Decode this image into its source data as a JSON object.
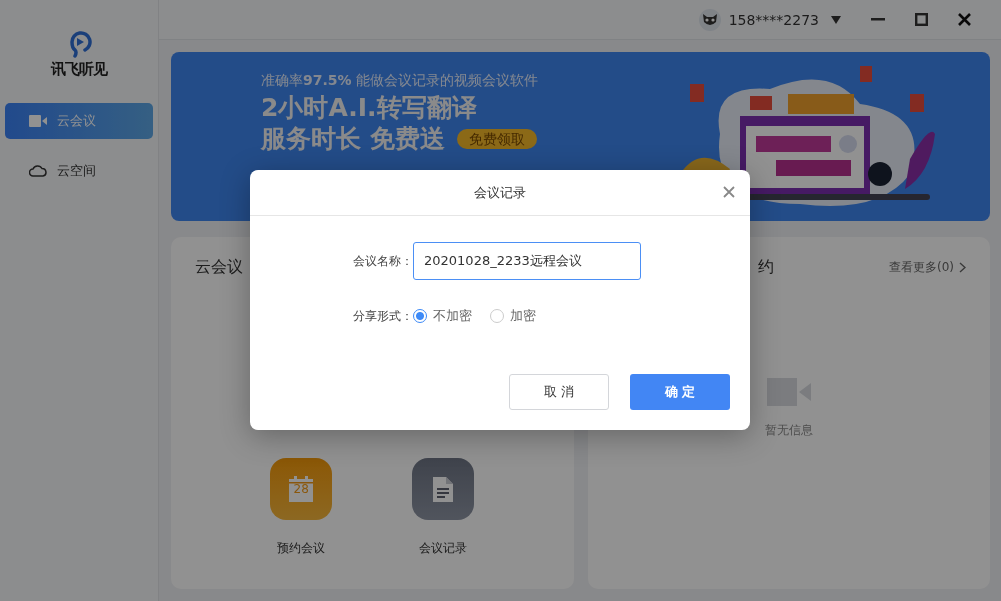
{
  "window": {
    "user": "158****2273"
  },
  "sidebar": {
    "logo": "讯飞听见",
    "items": [
      {
        "label": "云会议",
        "selected": true,
        "kind": "video"
      },
      {
        "label": "云空间",
        "selected": false,
        "kind": "cloud"
      }
    ]
  },
  "banner": {
    "tagline": "准确率**97.5%** 能做会议记录的视频会议软件",
    "headline": "2小时A.I.转写翻译",
    "subline": "服务时长 免费送",
    "cta": "免费领取"
  },
  "meetings_card": {
    "title": "云会议",
    "actions": [
      {
        "label": "预约会议",
        "kind": "calendar",
        "icon_text": "28"
      },
      {
        "label": "会议记录",
        "kind": "document"
      }
    ]
  },
  "schedule_card": {
    "title": "约",
    "more": "查看更多(0)",
    "empty": "暂无信息"
  },
  "dialog": {
    "title": "会议记录",
    "name_label": "会议名称：",
    "name_value": "20201028_2233远程会议",
    "share_label": "分享形式：",
    "options": [
      {
        "label": "不加密",
        "selected": true
      },
      {
        "label": "加密",
        "selected": false
      }
    ],
    "buttons": [
      {
        "label": "取 消",
        "kind": "secondary"
      },
      {
        "label": "确 定",
        "kind": "primary"
      }
    ]
  }
}
